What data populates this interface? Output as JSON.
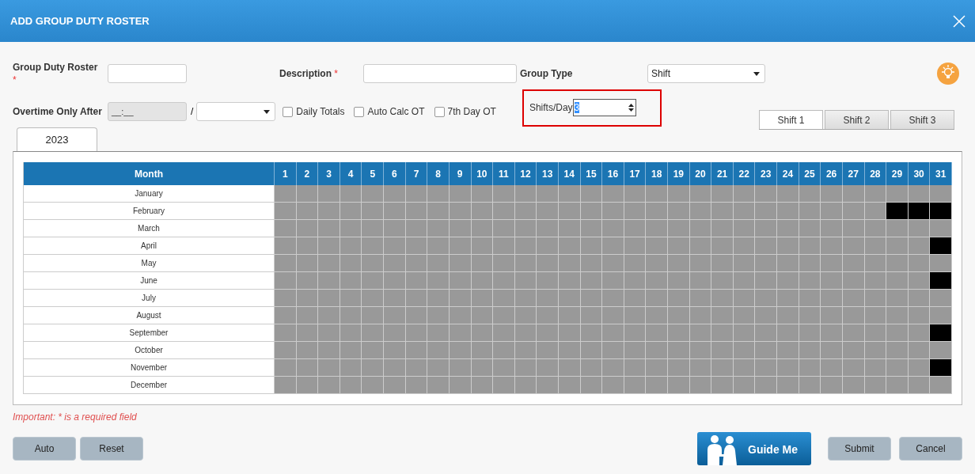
{
  "window": {
    "title": "ADD GROUP DUTY ROSTER"
  },
  "form": {
    "group_duty_roster": {
      "label": "Group Duty Roster",
      "required_mark": "*"
    },
    "description": {
      "label": "Description",
      "required_mark": "*"
    },
    "group_type": {
      "label": "Group Type",
      "value": "Shift"
    },
    "overtime": {
      "label": "Overtime Only After",
      "value": "__:__",
      "separator": "/"
    },
    "checkboxes": [
      {
        "label": "Daily Totals",
        "checked": false
      },
      {
        "label": "Auto Calc OT",
        "checked": false
      },
      {
        "label": "7th Day OT",
        "checked": false
      }
    ],
    "shifts_per_day": {
      "label": "Shifts/Day",
      "value": "3"
    }
  },
  "year_tabs": [
    {
      "label": "2023",
      "selected": true
    }
  ],
  "shift_tabs": [
    {
      "label": "Shift 1",
      "selected": true
    },
    {
      "label": "Shift 2",
      "selected": false
    },
    {
      "label": "Shift 3",
      "selected": false
    }
  ],
  "table": {
    "month_header": "Month",
    "days": [
      "1",
      "2",
      "3",
      "4",
      "5",
      "6",
      "7",
      "8",
      "9",
      "10",
      "11",
      "12",
      "13",
      "14",
      "15",
      "16",
      "17",
      "18",
      "19",
      "20",
      "21",
      "22",
      "23",
      "24",
      "25",
      "26",
      "27",
      "28",
      "29",
      "30",
      "31"
    ],
    "months": [
      {
        "name": "January",
        "blocked": [
          false,
          false,
          false,
          false,
          false,
          false,
          false,
          false,
          false,
          false,
          false,
          false,
          false,
          false,
          false,
          false,
          false,
          false,
          false,
          false,
          false,
          false,
          false,
          false,
          false,
          false,
          false,
          false,
          false,
          false,
          false
        ]
      },
      {
        "name": "February",
        "blocked": [
          false,
          false,
          false,
          false,
          false,
          false,
          false,
          false,
          false,
          false,
          false,
          false,
          false,
          false,
          false,
          false,
          false,
          false,
          false,
          false,
          false,
          false,
          false,
          false,
          false,
          false,
          false,
          false,
          true,
          true,
          true
        ]
      },
      {
        "name": "March",
        "blocked": [
          false,
          false,
          false,
          false,
          false,
          false,
          false,
          false,
          false,
          false,
          false,
          false,
          false,
          false,
          false,
          false,
          false,
          false,
          false,
          false,
          false,
          false,
          false,
          false,
          false,
          false,
          false,
          false,
          false,
          false,
          false
        ]
      },
      {
        "name": "April",
        "blocked": [
          false,
          false,
          false,
          false,
          false,
          false,
          false,
          false,
          false,
          false,
          false,
          false,
          false,
          false,
          false,
          false,
          false,
          false,
          false,
          false,
          false,
          false,
          false,
          false,
          false,
          false,
          false,
          false,
          false,
          false,
          true
        ]
      },
      {
        "name": "May",
        "blocked": [
          false,
          false,
          false,
          false,
          false,
          false,
          false,
          false,
          false,
          false,
          false,
          false,
          false,
          false,
          false,
          false,
          false,
          false,
          false,
          false,
          false,
          false,
          false,
          false,
          false,
          false,
          false,
          false,
          false,
          false,
          false
        ]
      },
      {
        "name": "June",
        "blocked": [
          false,
          false,
          false,
          false,
          false,
          false,
          false,
          false,
          false,
          false,
          false,
          false,
          false,
          false,
          false,
          false,
          false,
          false,
          false,
          false,
          false,
          false,
          false,
          false,
          false,
          false,
          false,
          false,
          false,
          false,
          true
        ]
      },
      {
        "name": "July",
        "blocked": [
          false,
          false,
          false,
          false,
          false,
          false,
          false,
          false,
          false,
          false,
          false,
          false,
          false,
          false,
          false,
          false,
          false,
          false,
          false,
          false,
          false,
          false,
          false,
          false,
          false,
          false,
          false,
          false,
          false,
          false,
          false
        ]
      },
      {
        "name": "August",
        "blocked": [
          false,
          false,
          false,
          false,
          false,
          false,
          false,
          false,
          false,
          false,
          false,
          false,
          false,
          false,
          false,
          false,
          false,
          false,
          false,
          false,
          false,
          false,
          false,
          false,
          false,
          false,
          false,
          false,
          false,
          false,
          false
        ]
      },
      {
        "name": "September",
        "blocked": [
          false,
          false,
          false,
          false,
          false,
          false,
          false,
          false,
          false,
          false,
          false,
          false,
          false,
          false,
          false,
          false,
          false,
          false,
          false,
          false,
          false,
          false,
          false,
          false,
          false,
          false,
          false,
          false,
          false,
          false,
          true
        ]
      },
      {
        "name": "October",
        "blocked": [
          false,
          false,
          false,
          false,
          false,
          false,
          false,
          false,
          false,
          false,
          false,
          false,
          false,
          false,
          false,
          false,
          false,
          false,
          false,
          false,
          false,
          false,
          false,
          false,
          false,
          false,
          false,
          false,
          false,
          false,
          false
        ]
      },
      {
        "name": "November",
        "blocked": [
          false,
          false,
          false,
          false,
          false,
          false,
          false,
          false,
          false,
          false,
          false,
          false,
          false,
          false,
          false,
          false,
          false,
          false,
          false,
          false,
          false,
          false,
          false,
          false,
          false,
          false,
          false,
          false,
          false,
          false,
          true
        ]
      },
      {
        "name": "December",
        "blocked": [
          false,
          false,
          false,
          false,
          false,
          false,
          false,
          false,
          false,
          false,
          false,
          false,
          false,
          false,
          false,
          false,
          false,
          false,
          false,
          false,
          false,
          false,
          false,
          false,
          false,
          false,
          false,
          false,
          false,
          false,
          false
        ]
      }
    ]
  },
  "note": "Important: * is a required field",
  "buttons_left": [
    "Auto",
    "Reset"
  ],
  "guide_button": "Guide Me",
  "buttons_right": [
    "Submit",
    "Cancel"
  ]
}
